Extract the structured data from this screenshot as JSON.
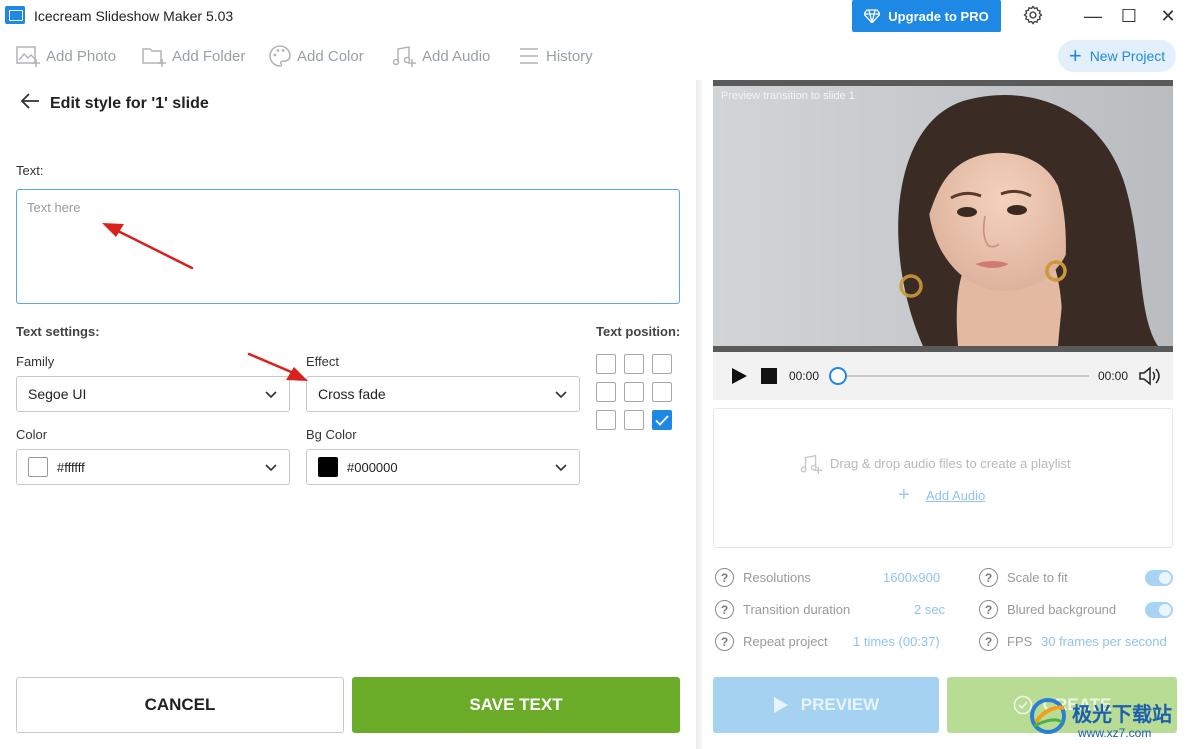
{
  "window": {
    "title": "Icecream Slideshow Maker 5.03",
    "upgrade_label": "Upgrade to PRO",
    "minimize": "—",
    "maximize": "☐",
    "close": "✕"
  },
  "toolbar": {
    "items": [
      {
        "label": "Add Photo",
        "icon": "add-photo-icon"
      },
      {
        "label": "Add Folder",
        "icon": "add-folder-icon"
      },
      {
        "label": "Add Color",
        "icon": "palette-icon"
      },
      {
        "label": "Add Audio",
        "icon": "add-audio-icon"
      },
      {
        "label": "History",
        "icon": "history-icon"
      }
    ],
    "new_project_label": "New Project"
  },
  "editor": {
    "title": "Edit style for '1' slide",
    "text_label": "Text:",
    "text_placeholder": "Text here",
    "text_value": "",
    "settings_label": "Text settings:",
    "family_label": "Family",
    "family_value": "Segoe UI",
    "effect_label": "Effect",
    "effect_value": "Cross fade",
    "color_label": "Color",
    "color_value": "#ffffff",
    "bg_color_label": "Bg Color",
    "bg_color_value": "#000000",
    "position_label": "Text position:",
    "position_selected": "bottom-right",
    "cancel_label": "CANCEL",
    "save_label": "SAVE TEXT"
  },
  "preview": {
    "caption": "Preview transition to slide 1",
    "time_current": "00:00",
    "time_total": "00:00",
    "progress": 0
  },
  "audio": {
    "drop_text": "Drag & drop audio files to create a playlist",
    "add_label": "Add Audio"
  },
  "settings": {
    "resolutions_label": "Resolutions",
    "resolutions_value": "1600x900",
    "transition_label": "Transition duration",
    "transition_value": "2 sec",
    "repeat_label": "Repeat project",
    "repeat_value": "1 times (00:37)",
    "scale_label": "Scale to fit",
    "scale_on": true,
    "blurred_label": "Blured background",
    "blurred_on": true,
    "fps_label": "FPS",
    "fps_value": "30 frames per second"
  },
  "footer": {
    "preview_label": "PREVIEW",
    "create_label": "CREATE"
  },
  "watermark": {
    "text": "极光下载站",
    "url": "www.xz7.com"
  },
  "colors": {
    "accent": "#1e88e5",
    "save_green": "#6aab27",
    "arrow_red": "#d9221c"
  }
}
